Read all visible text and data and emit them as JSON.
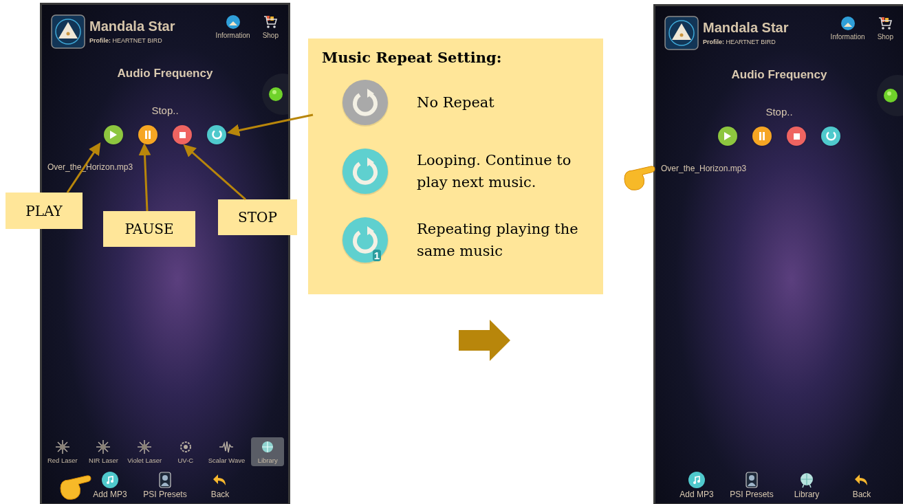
{
  "phones": [
    {
      "app_title": "Mandala Star",
      "profile": "**Profile:** HEARTNET BIRD",
      "header_buttons": [
        {
          "kind": "information",
          "label": "Information"
        },
        {
          "kind": "shop",
          "label": "Shop"
        }
      ],
      "screen_title": "Audio Frequency",
      "status": "Stop..",
      "controls": [
        {
          "kind": "play"
        },
        {
          "kind": "pause"
        },
        {
          "kind": "stop"
        },
        {
          "kind": "repeat"
        }
      ],
      "track": "Over_the_Horizon.mp3",
      "modes": [
        {
          "kind": "laser",
          "label": "Red Laser",
          "selected": false
        },
        {
          "kind": "laser",
          "label": "NIR Laser",
          "selected": false
        },
        {
          "kind": "laser",
          "label": "Violet Laser",
          "selected": false
        },
        {
          "kind": "uvc",
          "label": "UV-C",
          "selected": false
        },
        {
          "kind": "scalar",
          "label": "Scalar Wave",
          "selected": false
        },
        {
          "kind": "library",
          "label": "Library",
          "selected": true
        }
      ],
      "bottom_nav": [
        {
          "kind": "add_mp3",
          "label": "Add MP3"
        },
        {
          "kind": "psi_presets",
          "label": "PSI Presets"
        },
        {
          "kind": "back",
          "label": "Back"
        }
      ]
    },
    {
      "app_title": "Mandala Star",
      "profile": "**Profile:** HEARTNET BIRD",
      "header_buttons": [
        {
          "kind": "information",
          "label": "Information"
        },
        {
          "kind": "shop",
          "label": "Shop"
        }
      ],
      "screen_title": "Audio Frequency",
      "status": "Stop..",
      "controls": [
        {
          "kind": "play"
        },
        {
          "kind": "pause"
        },
        {
          "kind": "stop"
        },
        {
          "kind": "repeat"
        }
      ],
      "track": "Over_the_Horizon.mp3",
      "bottom_nav": [
        {
          "kind": "add_mp3",
          "label": "Add MP3"
        },
        {
          "kind": "psi_presets",
          "label": "PSI Presets"
        },
        {
          "kind": "library",
          "label": "Library"
        },
        {
          "kind": "back",
          "label": "Back"
        }
      ]
    }
  ],
  "legend": {
    "title": "Music Repeat Setting:",
    "items": [
      {
        "kind": "none",
        "label": "No Repeat"
      },
      {
        "kind": "loop",
        "label": "Looping. Continue to play next music."
      },
      {
        "kind": "single",
        "label": "Repeating playing the same music",
        "badge": "1"
      }
    ]
  },
  "callouts": [
    {
      "kind": "play",
      "label": "PLAY"
    },
    {
      "kind": "pause",
      "label": "PAUSE"
    },
    {
      "kind": "stop",
      "label": "STOP"
    }
  ]
}
